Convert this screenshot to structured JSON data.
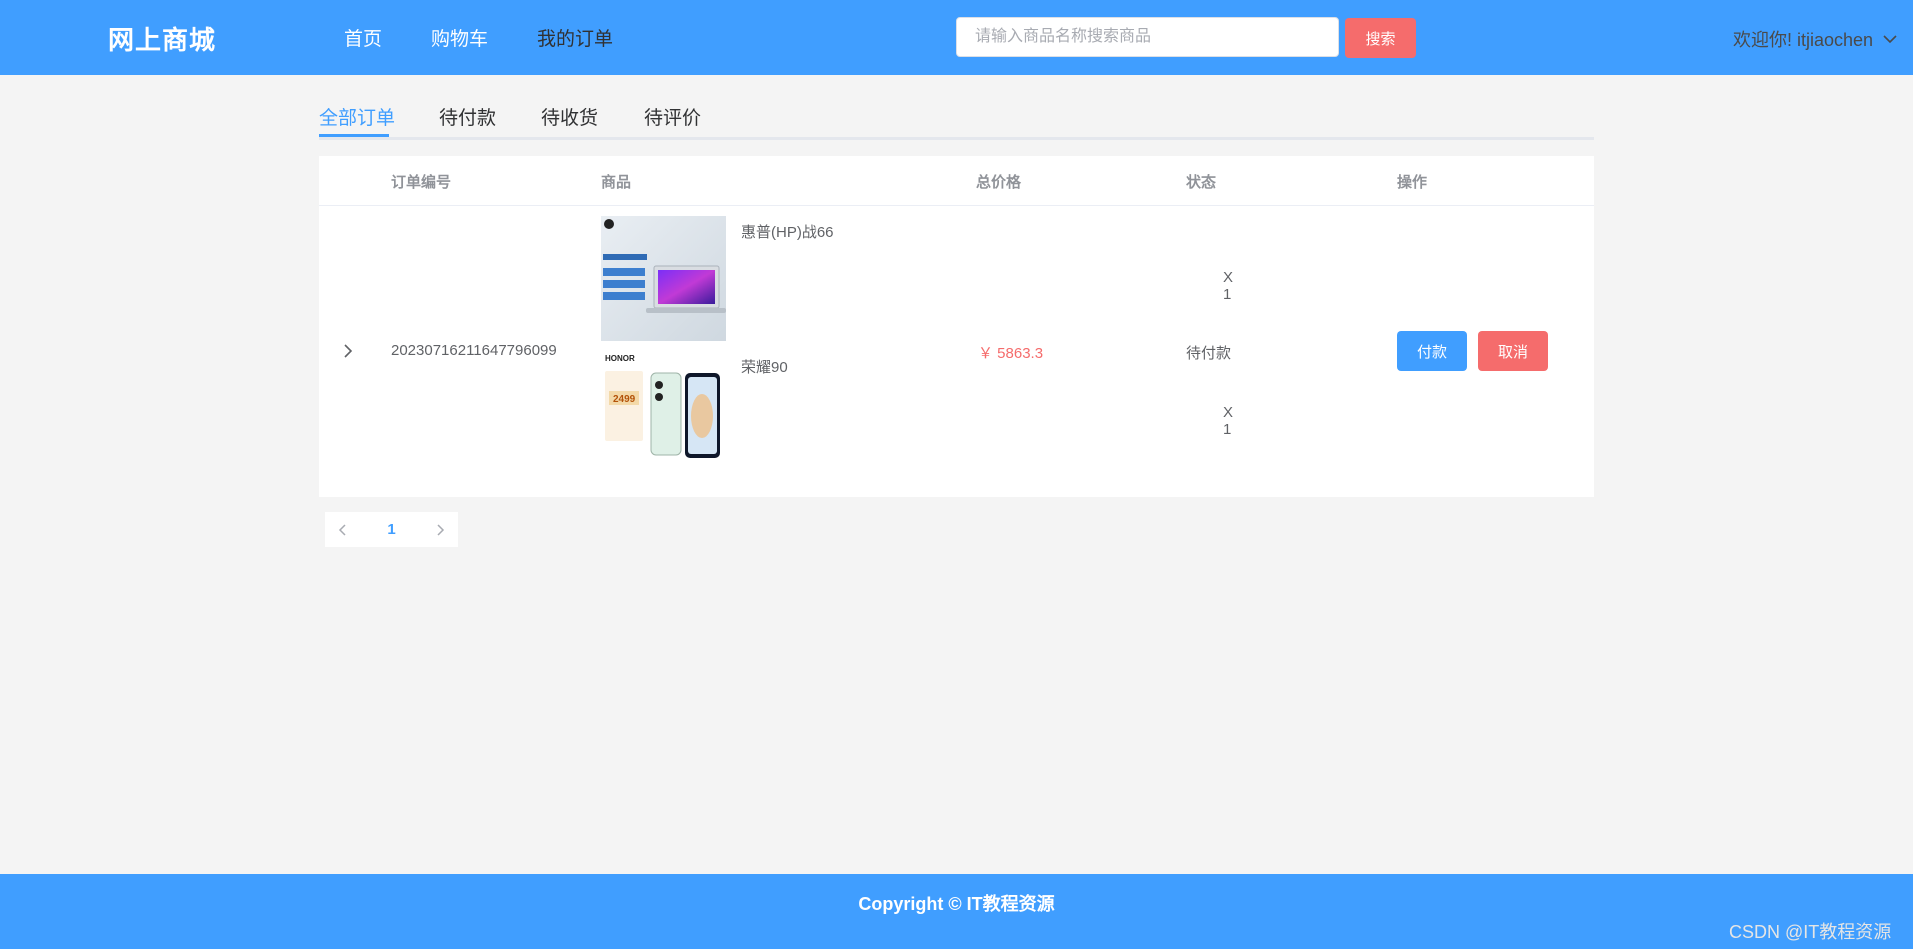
{
  "header": {
    "brand": "网上商城",
    "nav": [
      {
        "label": "首页"
      },
      {
        "label": "购物车"
      },
      {
        "label": "我的订单"
      }
    ],
    "search": {
      "placeholder": "请输入商品名称搜索商品",
      "value": "",
      "button_label": "搜索"
    },
    "user_greeting": "欢迎你!  itjiaochen"
  },
  "tabs": [
    {
      "label": "全部订单",
      "active": true
    },
    {
      "label": "待付款"
    },
    {
      "label": "待收货"
    },
    {
      "label": "待评价"
    }
  ],
  "table": {
    "columns": [
      "订单编号",
      "商品",
      "总价格",
      "状态",
      "操作"
    ],
    "rows": [
      {
        "order_no": "20230716211647796099",
        "items": [
          {
            "name": "惠普(HP)战66",
            "qty": "X 1"
          },
          {
            "name": "荣耀90",
            "qty": "X 1"
          }
        ],
        "total": "￥ 5863.3",
        "status": "待付款",
        "actions": {
          "pay": "付款",
          "cancel": "取消"
        }
      }
    ]
  },
  "pagination": {
    "current_page": "1"
  },
  "footer": {
    "copyright": "Copyright © IT教程资源"
  },
  "watermark": "CSDN @IT教程资源",
  "colors": {
    "primary": "#409eff",
    "danger": "#f56c6c",
    "background": "#f4f4f4"
  }
}
